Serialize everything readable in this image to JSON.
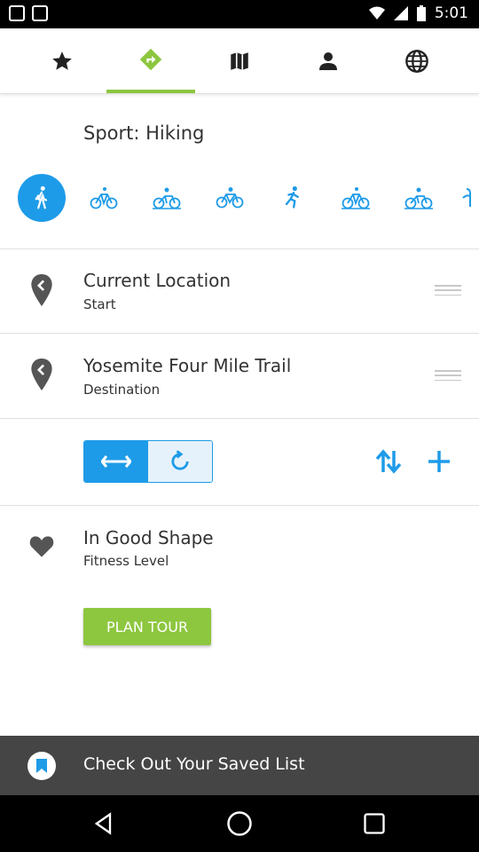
{
  "status_bar": {
    "time": "5:01"
  },
  "tabs": [
    {
      "icon": "star-icon",
      "active": false
    },
    {
      "icon": "directions-icon",
      "active": true
    },
    {
      "icon": "map-icon",
      "active": false
    },
    {
      "icon": "person-icon",
      "active": false
    },
    {
      "icon": "globe-icon",
      "active": false
    }
  ],
  "sport": {
    "label": "Sport: Hiking",
    "options": [
      {
        "icon": "hiking-icon",
        "active": true
      },
      {
        "icon": "bicycle-icon",
        "active": false
      },
      {
        "icon": "mountain-bike-icon",
        "active": false
      },
      {
        "icon": "road-bike-icon",
        "active": false
      },
      {
        "icon": "running-icon",
        "active": false
      },
      {
        "icon": "bicycle-icon",
        "active": false
      },
      {
        "icon": "mountain-bike-icon",
        "active": false
      },
      {
        "icon": "more-sport-icon",
        "active": false
      }
    ]
  },
  "route": {
    "start": {
      "title": "Current Location",
      "subtitle": "Start"
    },
    "destination": {
      "title": "Yosemite Four Mile Trail",
      "subtitle": "Destination"
    }
  },
  "fitness": {
    "title": "In Good Shape",
    "subtitle": "Fitness Level"
  },
  "plan_button": {
    "label": "PLAN TOUR"
  },
  "saved_list": {
    "label": "Check Out Your Saved List"
  },
  "colors": {
    "accent_green": "#8dc63f",
    "accent_blue": "#1e9be8",
    "dark_bar": "#454545",
    "icon_gray": "#555555"
  }
}
